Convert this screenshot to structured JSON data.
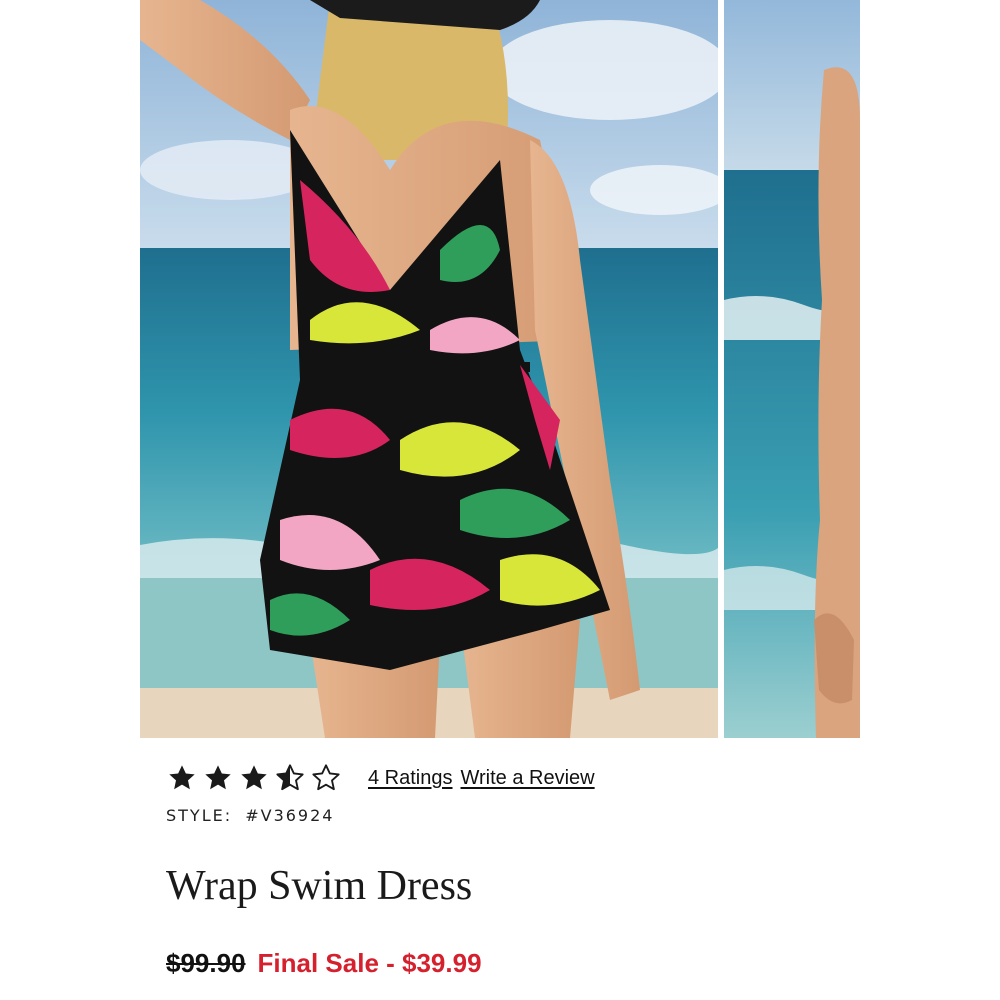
{
  "product": {
    "rating": {
      "value": 3.5,
      "max": 5,
      "ratings_link": "4 Ratings",
      "review_link": "Write a Review"
    },
    "style": {
      "label": "STYLE:",
      "number": "#V36924"
    },
    "title": "Wrap Swim Dress",
    "price": {
      "original": "$99.90",
      "sale": "Final Sale - $39.99"
    }
  },
  "gallery": {
    "images": [
      {
        "subject": "model-wrap-swim-dress-beach-front"
      },
      {
        "subject": "model-wrap-swim-dress-beach-next"
      }
    ]
  },
  "colors": {
    "sale_red": "#d5202e",
    "text": "#111111",
    "star_fill": "#1a1a1a",
    "dress_pink": "#d6245e",
    "dress_green": "#2e9e5a",
    "dress_lime": "#d8e63a",
    "sea": "#2f8fa8",
    "sky": "#bcd4e6",
    "sand": "#e8d5bd"
  }
}
